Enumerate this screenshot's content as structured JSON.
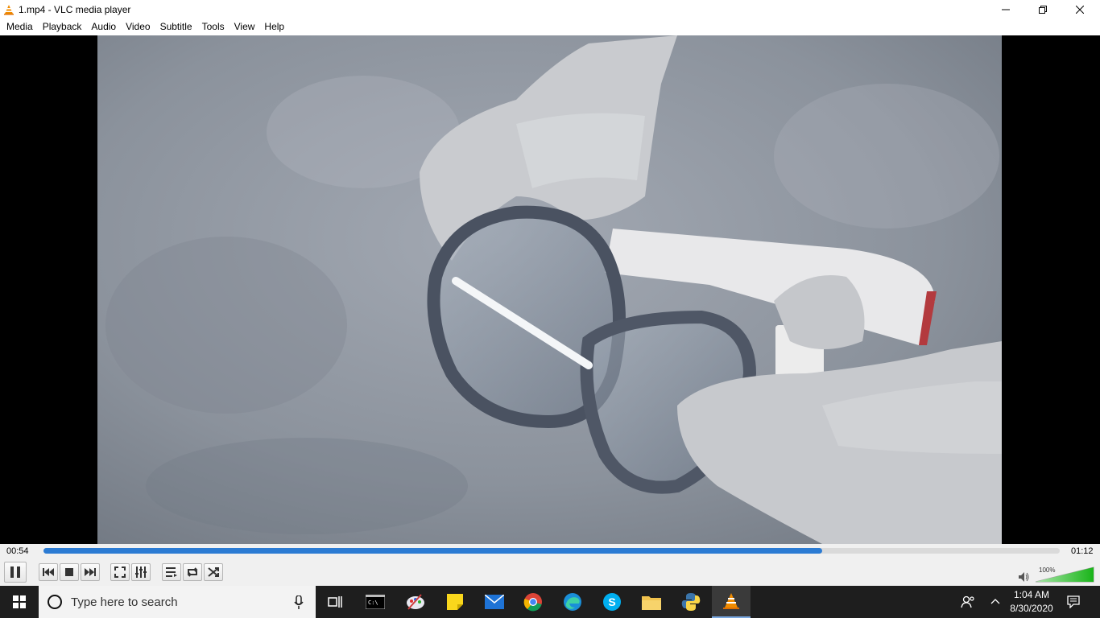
{
  "window": {
    "title": "1.mp4 - VLC media player",
    "icon": "vlc-cone-icon"
  },
  "menu": [
    "Media",
    "Playback",
    "Audio",
    "Video",
    "Subtitle",
    "Tools",
    "View",
    "Help"
  ],
  "player": {
    "elapsed": "00:54",
    "total": "01:12",
    "progress": 0.766,
    "volume_percent": "100%",
    "volume_level": 1.0,
    "accent_color": "#2b7bd3",
    "volume_color": "#3cc43c"
  },
  "controls": [
    "pause-icon",
    "previous-icon",
    "stop-icon",
    "next-icon",
    "fullscreen-icon",
    "extended-settings-icon",
    "playlist-icon",
    "loop-icon",
    "shuffle-icon"
  ],
  "taskbar": {
    "search_placeholder": "Type here to search",
    "apps": [
      "task-view-icon",
      "terminal-icon",
      "paint-icon",
      "sticky-notes-icon",
      "mail-icon",
      "chrome-icon",
      "edge-icon",
      "skype-icon",
      "file-explorer-icon",
      "python-icon",
      "vlc-icon"
    ],
    "time": "1:04 AM",
    "date": "8/30/2020"
  }
}
